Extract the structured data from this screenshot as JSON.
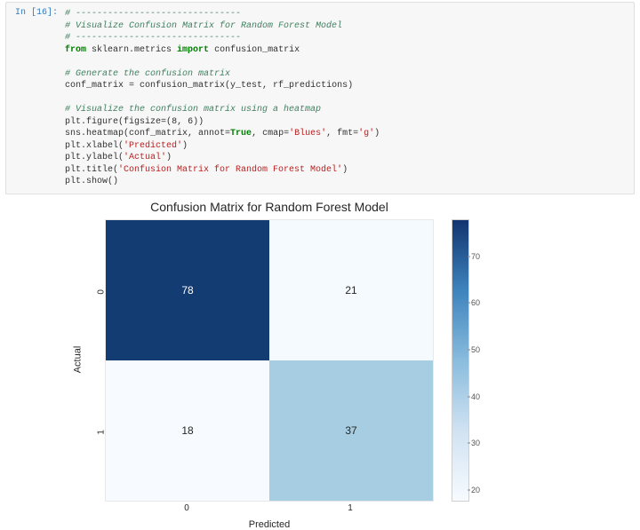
{
  "prompt": "In [16]:",
  "code": {
    "c1": "# -------------------------------",
    "c2": "# Visualize Confusion Matrix for Random Forest Model",
    "c3": "# -------------------------------",
    "kw_from": "from",
    "mod1": " sklearn.metrics ",
    "kw_import": "import",
    "mod2": " confusion_matrix",
    "c4": "# Generate the confusion matrix",
    "l5a": "conf_matrix ",
    "l5op": "=",
    "l5b": " confusion_matrix(y_test, rf_predictions)",
    "c6": "# Visualize the confusion matrix using a heatmap",
    "l7a": "plt.figure(figsize",
    "l7op": "=",
    "l7b": "(",
    "l7n1": "8",
    "l7c": ", ",
    "l7n2": "6",
    "l7d": "))",
    "l8a": "sns.heatmap(conf_matrix, annot",
    "l8op": "=",
    "l8t": "True",
    "l8b": ", cmap",
    "l8op2": "=",
    "l8s1": "'Blues'",
    "l8c": ", fmt",
    "l8op3": "=",
    "l8s2": "'g'",
    "l8d": ")",
    "l9a": "plt.xlabel(",
    "l9s": "'Predicted'",
    "l9b": ")",
    "l10a": "plt.ylabel(",
    "l10s": "'Actual'",
    "l10b": ")",
    "l11a": "plt.title(",
    "l11s": "'Confusion Matrix for Random Forest Model'",
    "l11b": ")",
    "l12": "plt.show()"
  },
  "chart_data": {
    "type": "heatmap",
    "title": "Confusion Matrix for Random Forest Model",
    "xlabel": "Predicted",
    "ylabel": "Actual",
    "x_ticks": [
      "0",
      "1"
    ],
    "y_ticks": [
      "0",
      "1"
    ],
    "matrix": [
      [
        78,
        21
      ],
      [
        18,
        37
      ]
    ],
    "cells": [
      {
        "value": 78,
        "bg": "#123c72",
        "fg": "#ffffff"
      },
      {
        "value": 21,
        "bg": "#f5faff",
        "fg": "#262626"
      },
      {
        "value": 18,
        "bg": "#f7fbff",
        "fg": "#262626"
      },
      {
        "value": 37,
        "bg": "#a7cde3",
        "fg": "#262626"
      }
    ],
    "colorbar": {
      "min": 18,
      "max": 78,
      "ticks": [
        20,
        30,
        40,
        50,
        60,
        70
      ]
    }
  }
}
